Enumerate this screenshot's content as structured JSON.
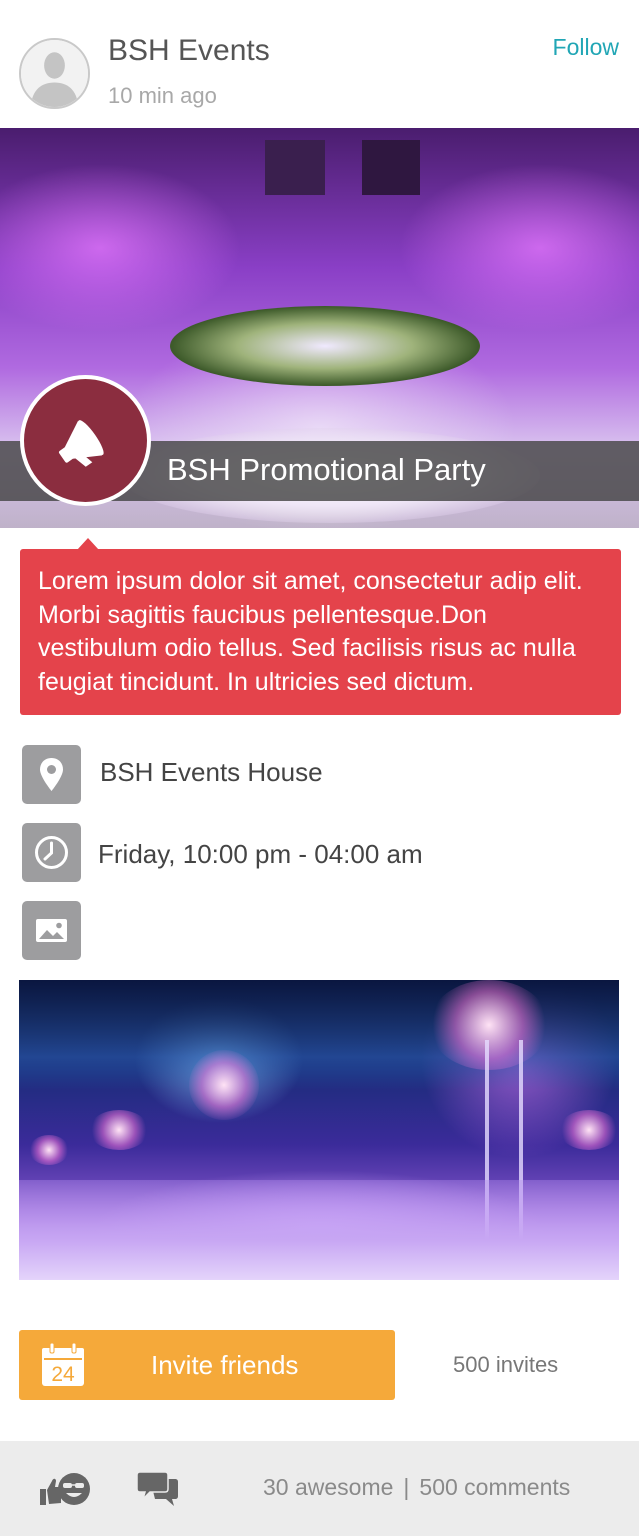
{
  "header": {
    "org_name": "BSH Events",
    "post_time": "10 min ago",
    "follow_label": "Follow"
  },
  "event": {
    "title": "BSH Promotional Party",
    "badge_icon": "megaphone-icon",
    "badge_color": "#8b2d3f",
    "description": "Lorem ipsum dolor sit amet, consectetur adip elit. Morbi sagittis faucibus pellentesque.Don vestibulum odio tellus. Sed facilisis risus ac nulla feugiat tincidunt. In ultricies sed dictum.",
    "description_color": "#e4434b"
  },
  "details": {
    "location": {
      "icon": "location-pin-icon",
      "text": "BSH Events House"
    },
    "time": {
      "icon": "clock-icon",
      "text": "Friday, 10:00 pm - 04:00 am"
    },
    "photos": {
      "icon": "image-icon"
    }
  },
  "invite": {
    "button_label": "Invite friends",
    "calendar_day": "24",
    "count_text": "500 invites",
    "button_color": "#f5a93a"
  },
  "footer": {
    "awesome_text": "30 awesome",
    "separator": "|",
    "comments_text": "500 comments",
    "awesome_icon": "thumbs-up-face-icon",
    "comment_icon": "speech-bubbles-icon"
  },
  "colors": {
    "accent": "#21a6b5",
    "icon_tile": "#9d9d9f"
  }
}
